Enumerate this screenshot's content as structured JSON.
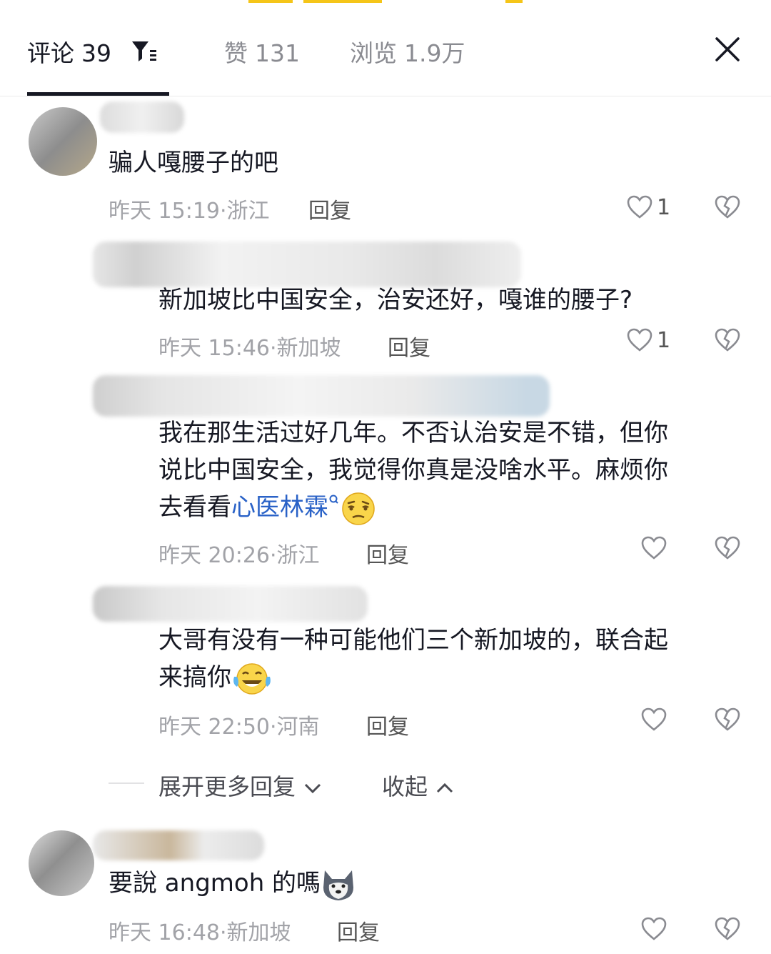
{
  "header": {
    "comments_label": "评论",
    "comments_count": "39",
    "likes_label": "赞",
    "likes_count": "131",
    "views_label": "浏览",
    "views_count": "1.9万"
  },
  "comments": [
    {
      "text": "骗人嘎腰子的吧",
      "time": "昨天 15:19",
      "location": "浙江",
      "reply": "回复",
      "likes": "1"
    },
    {
      "text": "新加坡比中国安全，治安还好，嘎谁的腰子?",
      "time": "昨天 15:46",
      "location": "新加坡",
      "reply": "回复",
      "likes": "1"
    },
    {
      "text_line1": "我在那生活过好几年。不否认治安是不错，但你",
      "text_line2": "说比中国安全，我觉得你真是没啥水平。麻烦你",
      "text_line3_prefix": "去看看",
      "text_line3_link": "心医林霖",
      "time": "昨天 20:26",
      "location": "浙江",
      "reply": "回复"
    },
    {
      "text_line1": "大哥有没有一种可能他们三个新加坡的，联合起",
      "text_line2_prefix": "来搞你",
      "time": "昨天 22:50",
      "location": "河南",
      "reply": "回复"
    },
    {
      "text_prefix": "要說 angmoh 的嗎",
      "time": "昨天 16:48",
      "location": "新加坡",
      "reply": "回复"
    }
  ],
  "expand_more": "展开更多回复",
  "collapse": "收起",
  "meta_separator": "·",
  "icons": [
    "filter-icon",
    "close-icon",
    "heart-icon",
    "dislike-icon",
    "search-hint-icon",
    "dizzy-face-emoji",
    "laughing-tears-emoji",
    "husky-emoji",
    "chevron-down-icon",
    "chevron-up-icon"
  ],
  "colors": {
    "accent_stripe": "#f5c518",
    "link": "#2a62c7",
    "text": "#161823",
    "meta": "#a2a3a8"
  }
}
